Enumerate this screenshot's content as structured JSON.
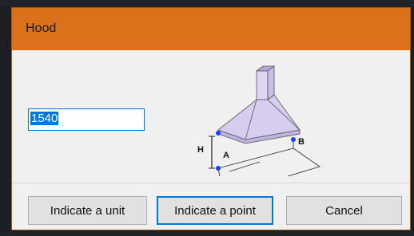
{
  "dialog": {
    "title": "Hood",
    "input_value": "1540",
    "illustration": {
      "labels": {
        "height": "H",
        "a": "A",
        "b": "B"
      }
    },
    "buttons": {
      "indicate_unit": "Indicate a unit",
      "indicate_point": "Indicate a point",
      "cancel": "Cancel"
    }
  },
  "colors": {
    "titlebar": "#db711b",
    "accent": "#0078d7",
    "hood": "#c9bfe6",
    "marker": "#1f3cff"
  }
}
